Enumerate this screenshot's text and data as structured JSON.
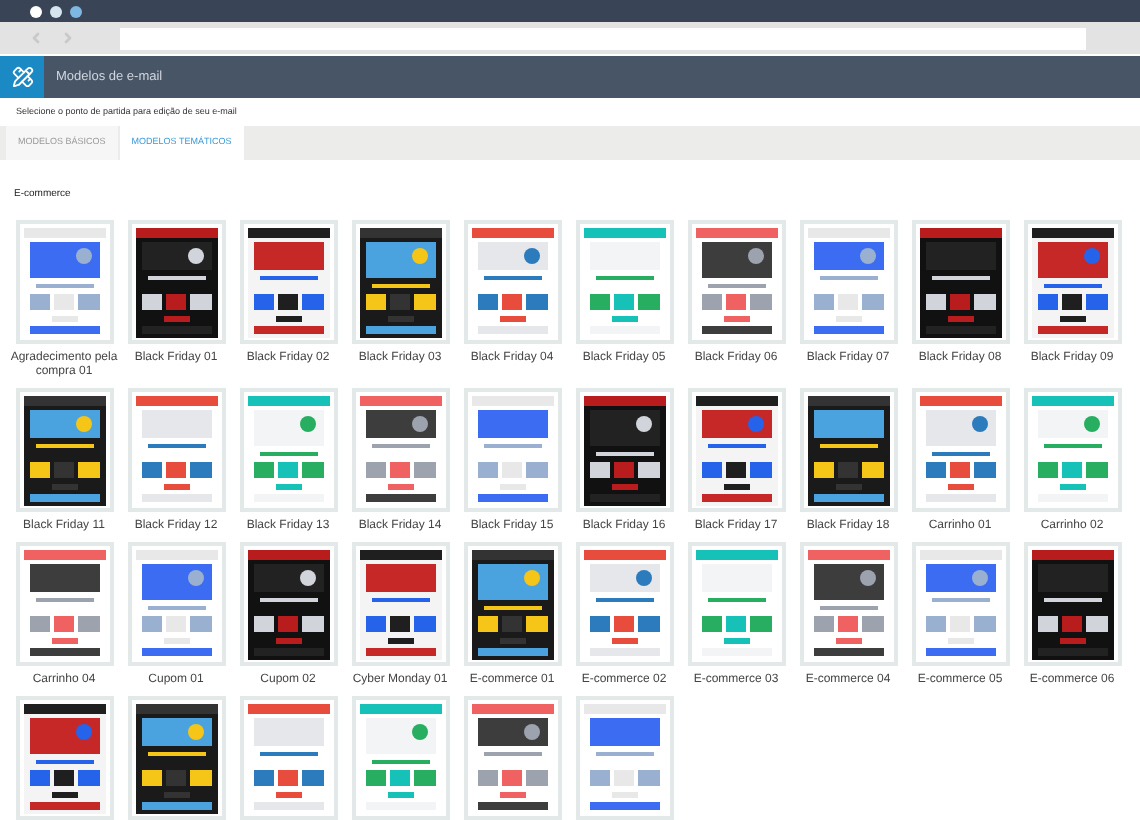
{
  "header": {
    "title": "Modelos de e-mail"
  },
  "subtitle": "Selecione o ponto de partida para edição de seu e-mail",
  "tabs": [
    {
      "label": "MODELOS BÁSICOS",
      "selected": false
    },
    {
      "label": "MODELOS TEMÁTICOS",
      "selected": true
    }
  ],
  "category": "E-commerce",
  "templates": [
    {
      "label": "Agradecimento pela compra 01",
      "thumbnail": {
        "kind": "picture"
      }
    },
    {
      "label": "Black Friday 01",
      "thumbnail": {
        "kind": "picture"
      }
    },
    {
      "label": "Black Friday 02",
      "thumbnail": {
        "kind": "picture"
      }
    },
    {
      "label": "Black Friday 03",
      "thumbnail": {
        "kind": "picture"
      }
    },
    {
      "label": "Black Friday 04",
      "thumbnail": {
        "kind": "picture"
      }
    },
    {
      "label": "Black Friday 05",
      "thumbnail": {
        "kind": "picture"
      }
    },
    {
      "label": "Black Friday 06",
      "thumbnail": {
        "kind": "picture"
      }
    },
    {
      "label": "Black Friday 07",
      "thumbnail": {
        "kind": "picture"
      }
    },
    {
      "label": "Black Friday 08",
      "thumbnail": {
        "kind": "picture"
      }
    },
    {
      "label": "Black Friday 09",
      "thumbnail": {
        "kind": "picture"
      }
    },
    {
      "label": "Black Friday 11",
      "thumbnail": {
        "kind": "picture"
      }
    },
    {
      "label": "Black Friday 12",
      "thumbnail": {
        "kind": "picture"
      }
    },
    {
      "label": "Black Friday 13",
      "thumbnail": {
        "kind": "picture"
      }
    },
    {
      "label": "Black Friday 14",
      "thumbnail": {
        "kind": "picture"
      }
    },
    {
      "label": "Black Friday 15",
      "thumbnail": {
        "kind": "picture"
      }
    },
    {
      "label": "Black Friday 16",
      "thumbnail": {
        "kind": "picture"
      }
    },
    {
      "label": "Black Friday 17",
      "thumbnail": {
        "kind": "picture"
      }
    },
    {
      "label": "Black Friday 18",
      "thumbnail": {
        "kind": "picture"
      }
    },
    {
      "label": "Carrinho 01",
      "thumbnail": {
        "kind": "picture"
      }
    },
    {
      "label": "Carrinho 02",
      "thumbnail": {
        "kind": "picture"
      }
    },
    {
      "label": "Carrinho 04",
      "thumbnail": {
        "kind": "picture"
      }
    },
    {
      "label": "Cupom 01",
      "thumbnail": {
        "kind": "picture"
      }
    },
    {
      "label": "Cupom 02",
      "thumbnail": {
        "kind": "picture"
      }
    },
    {
      "label": "Cyber Monday 01",
      "thumbnail": {
        "kind": "picture"
      }
    },
    {
      "label": "E-commerce 01",
      "thumbnail": {
        "kind": "picture"
      }
    },
    {
      "label": "E-commerce 02",
      "thumbnail": {
        "kind": "picture"
      }
    },
    {
      "label": "E-commerce 03",
      "thumbnail": {
        "kind": "picture"
      }
    },
    {
      "label": "E-commerce 04",
      "thumbnail": {
        "kind": "picture"
      }
    },
    {
      "label": "E-commerce 05",
      "thumbnail": {
        "kind": "picture"
      }
    },
    {
      "label": "E-commerce 06",
      "thumbnail": {
        "kind": "picture"
      }
    },
    {
      "thumbnail": {
        "kind": "picture"
      }
    },
    {
      "thumbnail": {
        "kind": "picture"
      }
    },
    {
      "thumbnail": {
        "kind": "picture"
      }
    },
    {
      "thumbnail": {
        "kind": "picture"
      }
    },
    {
      "thumbnail": {
        "kind": "picture"
      }
    },
    {
      "thumbnail": {
        "kind": "picture"
      }
    }
  ]
}
